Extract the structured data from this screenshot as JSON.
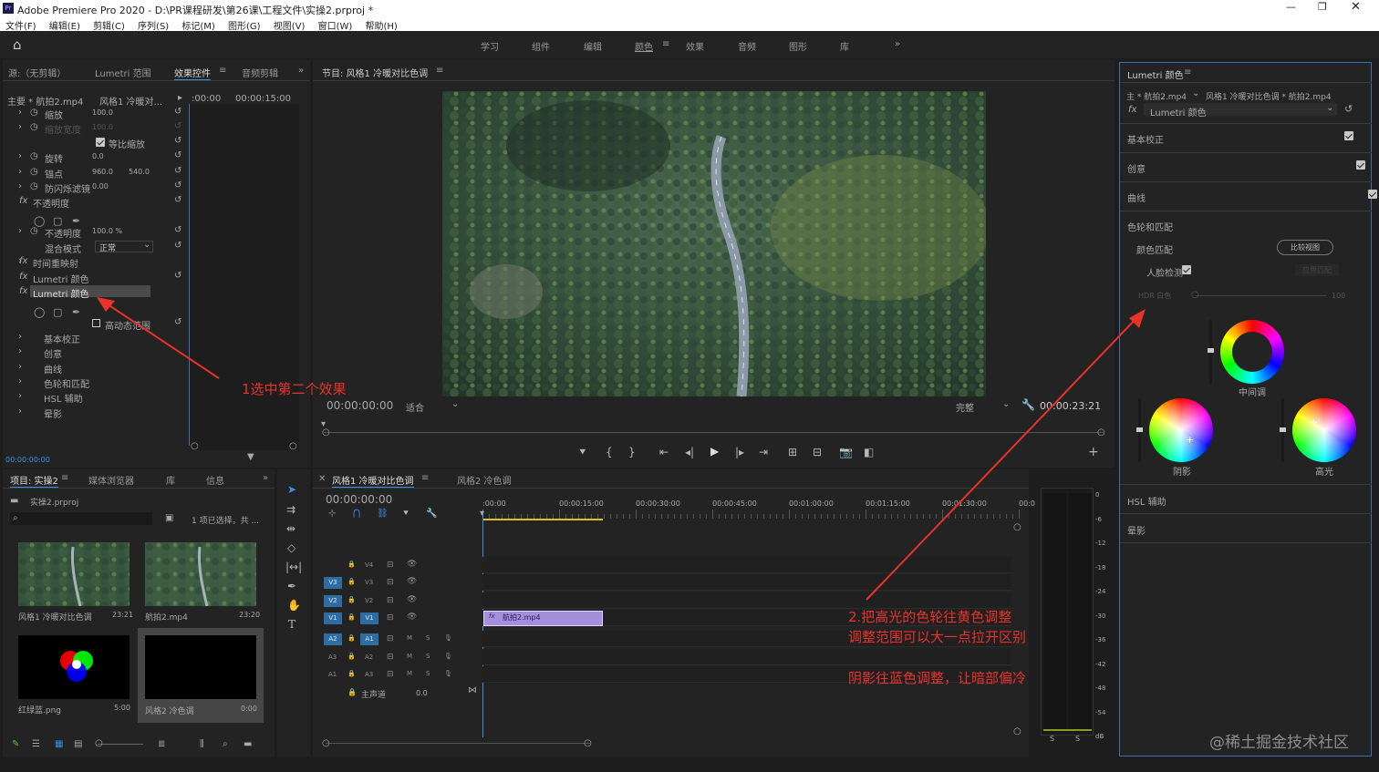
{
  "titlebar": {
    "title": "Adobe Premiere Pro 2020 - D:\\PR课程研发\\第26课\\工程文件\\实操2.prproj *"
  },
  "menu": [
    "文件(F)",
    "编辑(E)",
    "剪辑(C)",
    "序列(S)",
    "标记(M)",
    "图形(G)",
    "视图(V)",
    "窗口(W)",
    "帮助(H)"
  ],
  "workspaces": [
    "学习",
    "组件",
    "编辑",
    "颜色",
    "效果",
    "音频",
    "图形",
    "库"
  ],
  "active_workspace": "颜色",
  "source_panel": {
    "tabs": [
      "源:（无剪辑）",
      "Lumetri 范围",
      "效果控件",
      "音频剪辑"
    ],
    "master_label": "主要 * 航拍2.mp4",
    "sequence_label": "风格1 冷暖对...",
    "time_start": ":00:00",
    "time_end": "00:00:15:00",
    "rows": [
      {
        "label": "缩放",
        "value": "100.0"
      },
      {
        "label": "缩放宽度",
        "value": "100.0"
      },
      {
        "label": "等比缩放",
        "value": ""
      },
      {
        "label": "旋转",
        "value": "0.0"
      },
      {
        "label": "锚点",
        "value": "960.0",
        "value2": "540.0"
      },
      {
        "label": "防闪烁滤镜",
        "value": "0.00"
      },
      {
        "label": "不透明度",
        "value": ""
      },
      {
        "label": "不透明度",
        "value": "100.0 %"
      },
      {
        "label": "混合模式",
        "value": "正常"
      },
      {
        "label": "时间重映射",
        "value": ""
      },
      {
        "label": "Lumetri 颜色",
        "value": ""
      },
      {
        "label": "Lumetri 颜色",
        "value": ""
      },
      {
        "label": "高动态范围",
        "value": ""
      },
      {
        "label": "基本校正",
        "value": ""
      },
      {
        "label": "创意",
        "value": ""
      },
      {
        "label": "曲线",
        "value": ""
      },
      {
        "label": "色轮和匹配",
        "value": ""
      },
      {
        "label": "HSL 辅助",
        "value": ""
      },
      {
        "label": "晕影",
        "value": ""
      }
    ],
    "timecode": "00:00:00:00"
  },
  "program": {
    "title": "节目: 风格1 冷暖对比色调",
    "timecode": "00:00:00:00",
    "fit": "适合",
    "quality": "完整",
    "duration": "00:00:23:21"
  },
  "lumetri": {
    "title": "Lumetri 颜色",
    "master": "主 * 航拍2.mp4",
    "sequence": "风格1 冷暖对比色调 * 航拍2.mp4",
    "fx": "Lumetri 颜色",
    "sections": [
      "基本校正",
      "创意",
      "曲线",
      "色轮和匹配"
    ],
    "color_match": "颜色匹配",
    "compare_button": "比较视图",
    "face_detect": "人脸检测",
    "apply_match": "应用匹配",
    "hdr_label": "HDR 白色",
    "hdr_value": "100",
    "wheels": {
      "mid": "中间调",
      "shadow": "阴影",
      "highlight": "高光"
    },
    "hsl": "HSL 辅助",
    "vignette": "晕影"
  },
  "project": {
    "tabs": [
      "项目: 实操2",
      "媒体浏览器",
      "库",
      "信息"
    ],
    "file": "实操2.prproj",
    "selection": "1 项已选择，共 ...",
    "items": [
      {
        "name": "风格1 冷暖对比色调",
        "dur": "23:21"
      },
      {
        "name": "航拍2.mp4",
        "dur": "23:20"
      },
      {
        "name": "红绿蓝.png",
        "dur": "5:00"
      },
      {
        "name": "风格2 冷色调",
        "dur": "0:00"
      }
    ]
  },
  "timeline": {
    "tabs": [
      "风格1 冷暖对比色调",
      "风格2 冷色调"
    ],
    "timecode": "00:00:00:00",
    "ruler": [
      ":00:00",
      "00:00:15:00",
      "00:00:30:00",
      "00:00:45:00",
      "00:01:00:00",
      "00:01:15:00",
      "00:01:30:00",
      "00:0"
    ],
    "clip": "航拍2.mp4",
    "master": "主声道",
    "master_value": "0.0",
    "meter_scale": [
      "0",
      "-6",
      "-12",
      "-18",
      "-24",
      "-30",
      "-36",
      "-42",
      "-48",
      "-54",
      "dB"
    ]
  },
  "annotations": {
    "a1": "1选中第二个效果",
    "a2l1": "2.把高光的色轮往黄色调整",
    "a2l2": "调整范围可以大一点拉开区别",
    "a3": "阴影往蓝色调整，让暗部偏冷"
  },
  "watermark": "@稀土掘金技术社区"
}
